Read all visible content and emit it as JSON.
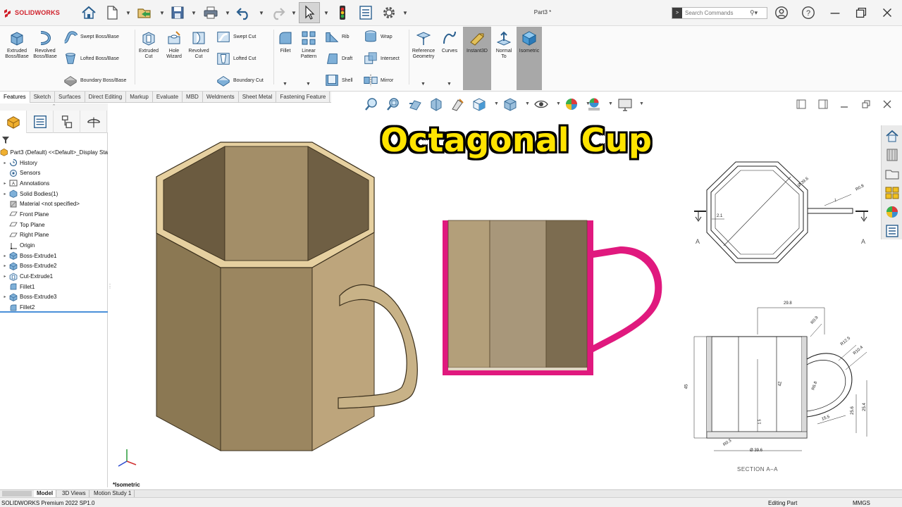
{
  "app": {
    "brand": "SOLIDWORKS",
    "doc_title": "Part3 *",
    "search_placeholder": "Search Commands"
  },
  "quick_access": {
    "icons": [
      "home-icon",
      "new-file-icon",
      "open-file-icon",
      "save-icon",
      "print-icon",
      "undo-icon",
      "redo-icon",
      "select-arrow-icon",
      "rebuild-traffic-light-icon",
      "file-properties-icon",
      "options-gear-icon"
    ]
  },
  "window_controls": [
    "user-icon",
    "help-icon",
    "minimize-icon",
    "restore-icon",
    "close-icon"
  ],
  "ribbon": {
    "extruded_boss": [
      "Extruded",
      "Boss/Base"
    ],
    "revolved_boss": [
      "Revolved",
      "Boss/Base"
    ],
    "swept_boss": "Swept Boss/Base",
    "lofted_boss": "Lofted Boss/Base",
    "boundary_boss": "Boundary Boss/Base",
    "extruded_cut": [
      "Extruded",
      "Cut"
    ],
    "hole_wizard": [
      "Hole",
      "Wizard"
    ],
    "revolved_cut": [
      "Revolved",
      "Cut"
    ],
    "swept_cut": "Swept Cut",
    "lofted_cut": "Lofted Cut",
    "boundary_cut": "Boundary Cut",
    "fillet": "Fillet",
    "linear_pattern": [
      "Linear",
      "Pattern"
    ],
    "rib": "Rib",
    "draft": "Draft",
    "shell": "Shell",
    "wrap": "Wrap",
    "intersect": "Intersect",
    "mirror": "Mirror",
    "reference_geometry": [
      "Reference",
      "Geometry"
    ],
    "curves": "Curves",
    "instant3d": "Instant3D",
    "normal_to": [
      "Normal",
      "To"
    ],
    "isometric": "Isometric"
  },
  "command_tabs": [
    "Features",
    "Sketch",
    "Surfaces",
    "Direct Editing",
    "Markup",
    "Evaluate",
    "MBD",
    "Weldments",
    "Sheet Metal",
    "Fastening Feature"
  ],
  "feature_tree": {
    "root": "Part3 (Default) <<Default>_Display Sta",
    "items": [
      {
        "label": "History",
        "expandable": true,
        "icon": "history-icon"
      },
      {
        "label": "Sensors",
        "expandable": false,
        "icon": "sensor-icon"
      },
      {
        "label": "Annotations",
        "expandable": true,
        "icon": "annotation-icon"
      },
      {
        "label": "Solid Bodies(1)",
        "expandable": true,
        "icon": "solid-bodies-icon"
      },
      {
        "label": "Material <not specified>",
        "expandable": false,
        "icon": "material-icon"
      },
      {
        "label": "Front Plane",
        "expandable": false,
        "icon": "plane-icon"
      },
      {
        "label": "Top Plane",
        "expandable": false,
        "icon": "plane-icon"
      },
      {
        "label": "Right Plane",
        "expandable": false,
        "icon": "plane-icon"
      },
      {
        "label": "Origin",
        "expandable": false,
        "icon": "origin-icon"
      },
      {
        "label": "Boss-Extrude1",
        "expandable": true,
        "icon": "boss-extrude-icon"
      },
      {
        "label": "Boss-Extrude2",
        "expandable": true,
        "icon": "boss-extrude-icon"
      },
      {
        "label": "Cut-Extrude1",
        "expandable": true,
        "icon": "cut-extrude-icon"
      },
      {
        "label": "Fillet1",
        "expandable": false,
        "icon": "fillet-icon"
      },
      {
        "label": "Boss-Extrude3",
        "expandable": true,
        "icon": "boss-extrude-icon"
      },
      {
        "label": "Fillet2",
        "expandable": false,
        "icon": "fillet-icon"
      }
    ]
  },
  "overlay_title": "Octagonal Cup",
  "drawing": {
    "top_view": {
      "dim_diameter": "Ø 39.6",
      "dim_wall": "2.1",
      "dim_handle_r": "R0.8",
      "dim_handle_small": "1",
      "section_left": "A",
      "section_right": "A"
    },
    "section_view": {
      "dim_width": "29.8",
      "dim_r_top": "R0.9",
      "dim_r1": "R12.5",
      "dim_r2": "R10.4",
      "dim_height_outer": "45",
      "dim_height_inner": "42",
      "dim_inner_r": "R6.8",
      "dim_bottom": "1.5",
      "dim_handle_w": "15.5",
      "dim_handle_h1": "25.6",
      "dim_handle_h2": "25.4",
      "dim_fillet": "R0.3",
      "dim_base": "Ø 39.6",
      "caption": "SECTION A–A"
    }
  },
  "viewport": {
    "view_label": "*Isometric"
  },
  "bottom_tabs": [
    "Model",
    "3D Views",
    "Motion Study 1"
  ],
  "status": {
    "version": "SOLIDWORKS Premium 2022 SP1.0",
    "mode": "Editing Part",
    "units": "MMGS"
  },
  "colors": {
    "cup_dark": "#7b6a4c",
    "cup_mid": "#a28d68",
    "cup_light": "#c8b48c",
    "cup_rim": "#e8d4a8",
    "section_magenta": "#e0197e",
    "title_yellow": "#ffe400",
    "brand_red": "#d0202a"
  }
}
